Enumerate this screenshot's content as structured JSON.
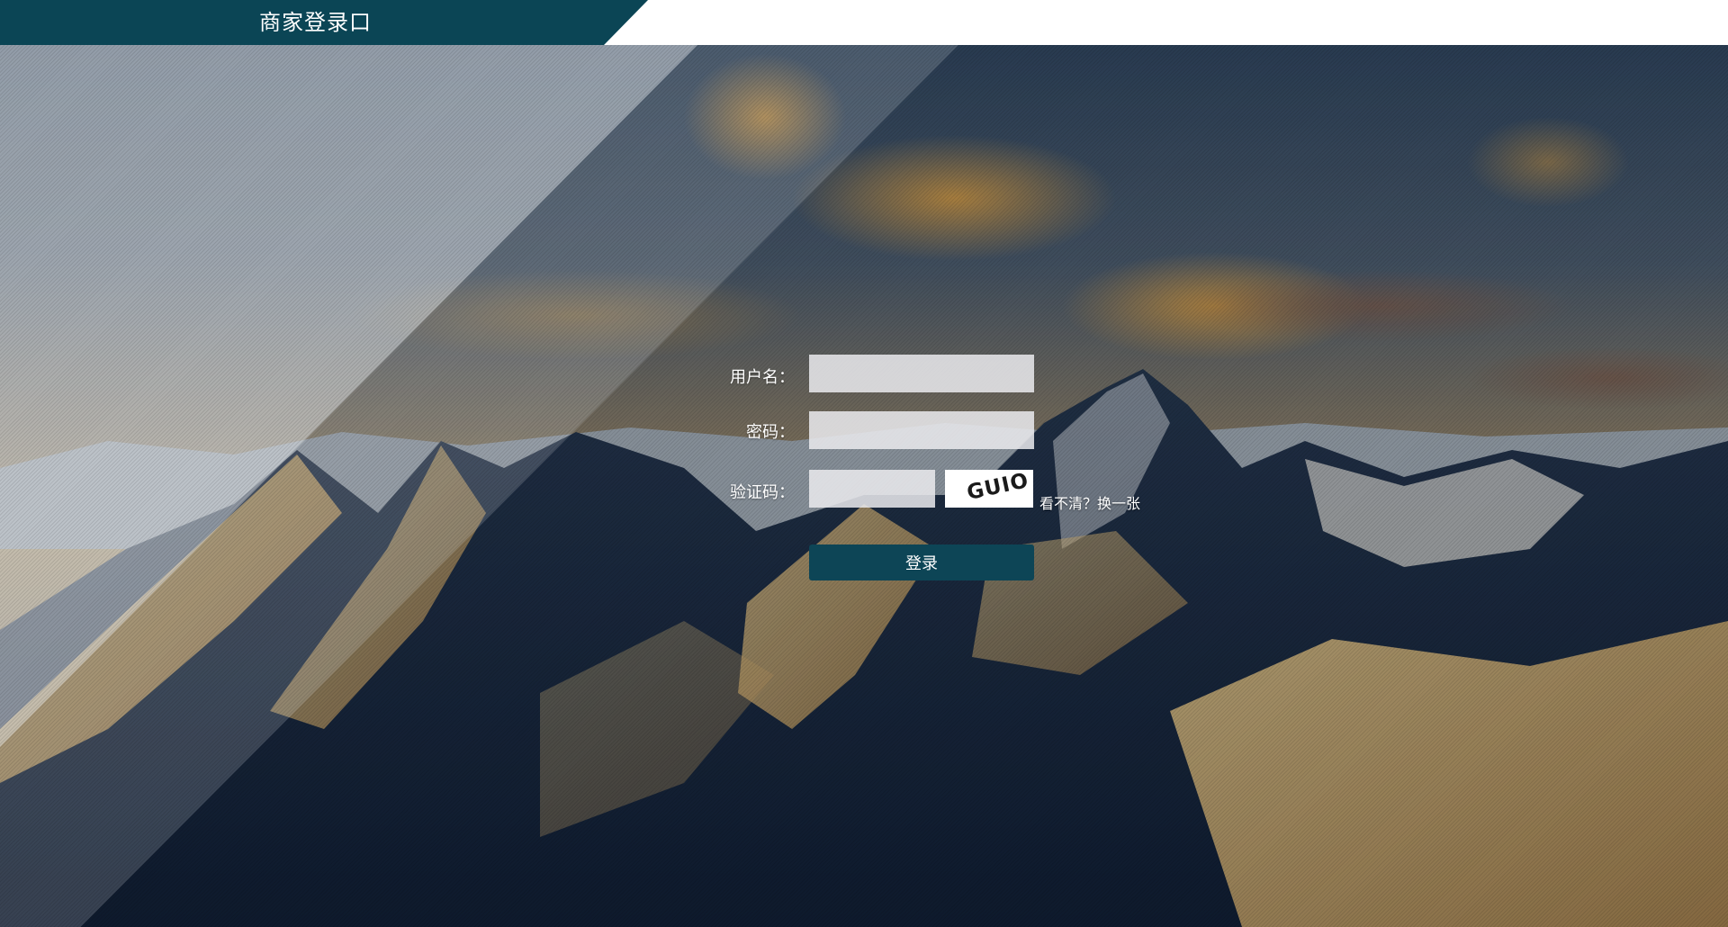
{
  "header": {
    "title": "商家登录口",
    "brand_color": "#0b4555"
  },
  "background": {
    "description_icon": "mountain-landscape-image"
  },
  "form": {
    "username_label": "用户名：",
    "username_value": "",
    "password_label": "密码：",
    "password_value": "",
    "captcha_label": "验证码：",
    "captcha_value": "",
    "captcha_image_text": "GUIO",
    "captcha_refresh_label": "看不清？换一张",
    "submit_label": "登录",
    "submit_color": "#0d4556"
  }
}
